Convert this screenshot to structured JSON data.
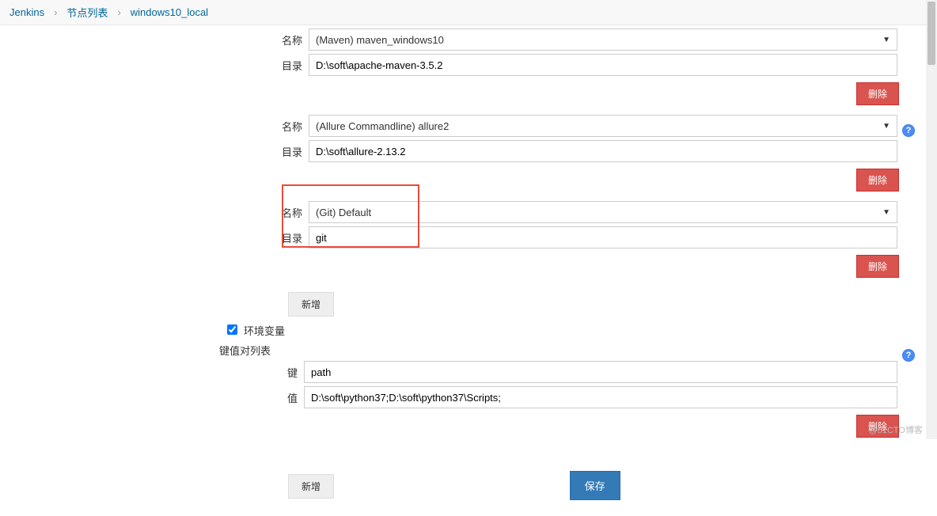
{
  "breadcrumb": {
    "items": [
      "Jenkins",
      "节点列表",
      "windows10_local"
    ]
  },
  "tools": [
    {
      "name_label": "名称",
      "name_value": "(Maven) maven_windows10",
      "dir_label": "目录",
      "dir_value": "D:\\soft\\apache-maven-3.5.2",
      "delete_label": "删除"
    },
    {
      "name_label": "名称",
      "name_value": "(Allure Commandline) allure2",
      "dir_label": "目录",
      "dir_value": "D:\\soft\\allure-2.13.2",
      "delete_label": "删除"
    },
    {
      "name_label": "名称",
      "name_value": "(Git) Default",
      "dir_label": "目录",
      "dir_value": "git",
      "delete_label": "删除"
    }
  ],
  "add_label": "新增",
  "env": {
    "checkbox_label": "环境变量",
    "kv_list_label": "键值对列表",
    "key_label": "键",
    "key_value": "path",
    "value_label": "值",
    "value_value": "D:\\soft\\python37;D:\\soft\\python37\\Scripts;",
    "delete_label": "删除",
    "add_label": "新增"
  },
  "save_label": "保存",
  "watermark": "@51CTO博客"
}
